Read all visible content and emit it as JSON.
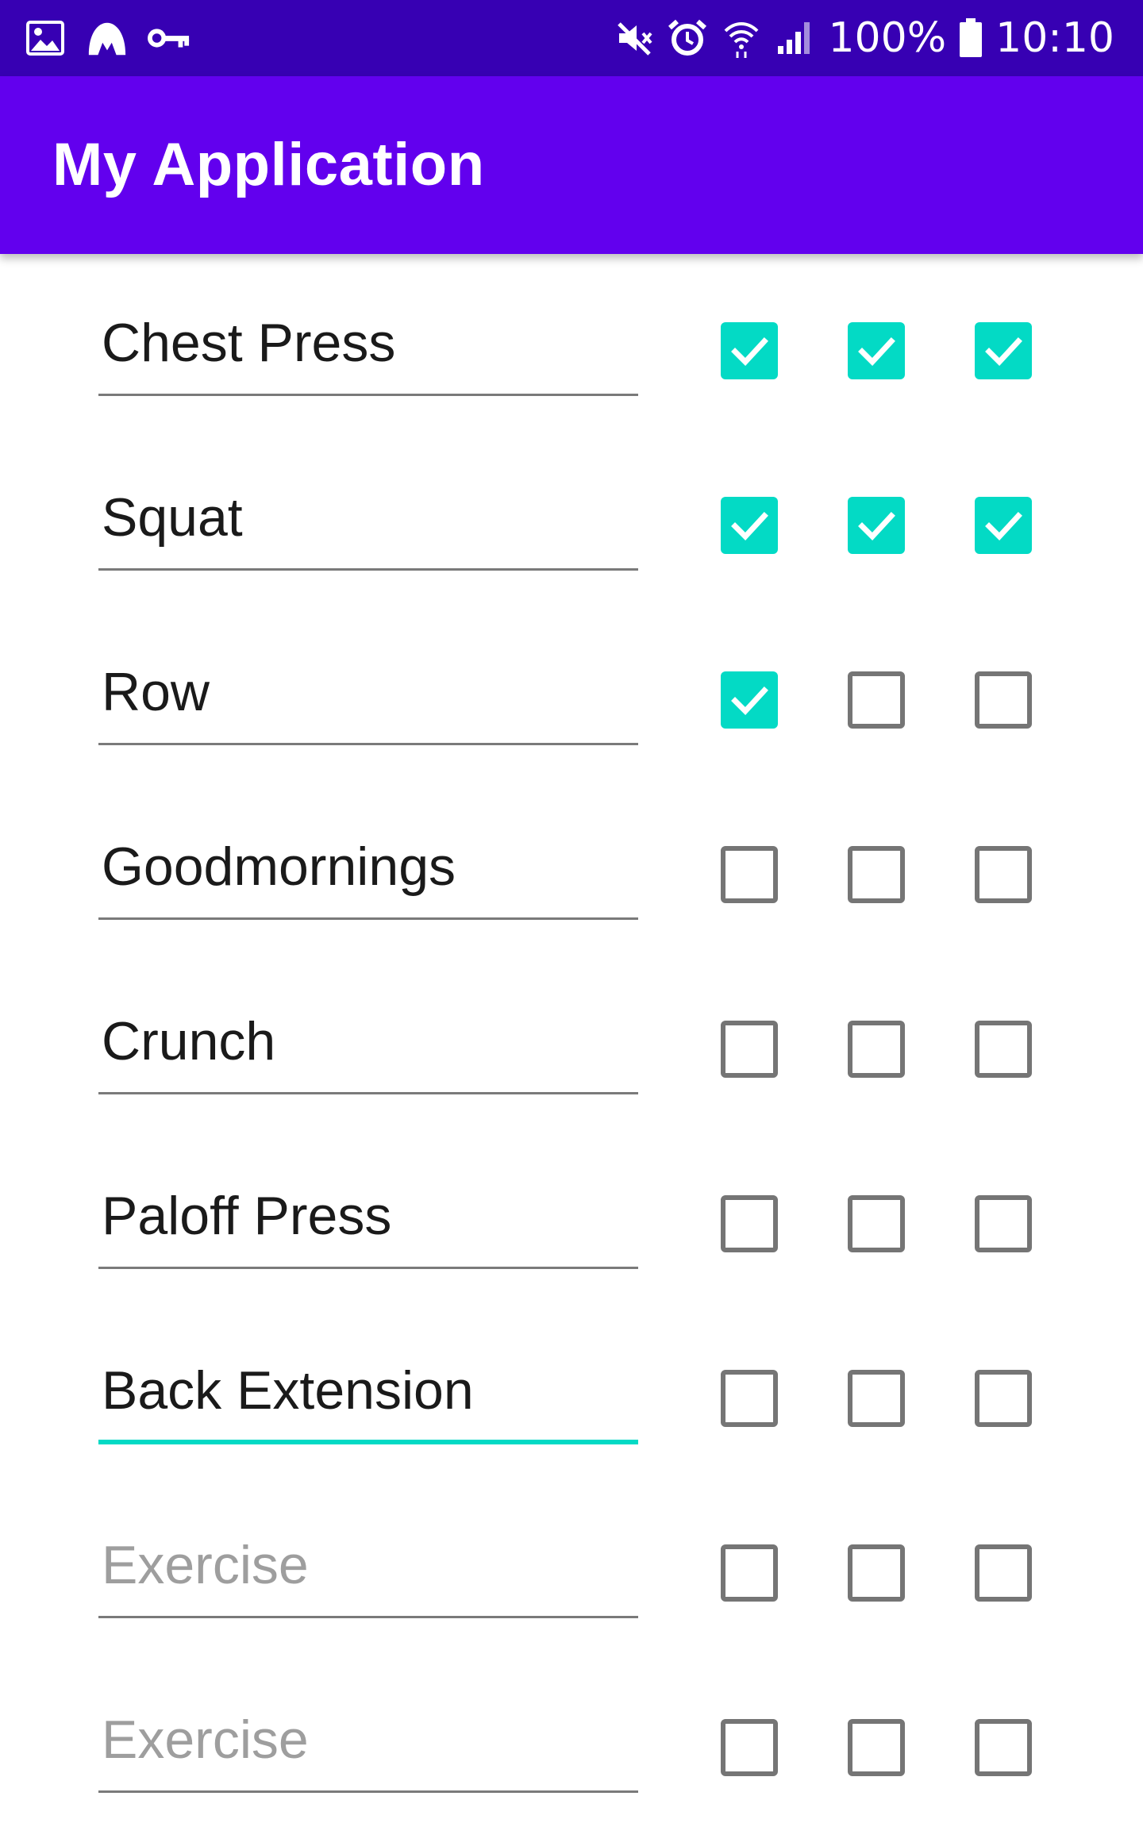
{
  "status_bar": {
    "battery_text": "100%",
    "time": "10:10",
    "left_icons": [
      "image-icon",
      "vpn-hat-icon",
      "key-icon"
    ],
    "right_icons": [
      "mute-icon",
      "alarm-icon",
      "wifi-icon",
      "signal-icon",
      "battery-icon"
    ]
  },
  "app_bar": {
    "title": "My Application"
  },
  "exercises": [
    {
      "value": "Chest Press",
      "placeholder": "",
      "sets": [
        true,
        true,
        true
      ]
    },
    {
      "value": "Squat",
      "placeholder": "",
      "sets": [
        true,
        true,
        true
      ]
    },
    {
      "value": "Row",
      "placeholder": "",
      "sets": [
        true,
        false,
        false
      ]
    },
    {
      "value": "Goodmornings",
      "placeholder": "",
      "sets": [
        false,
        false,
        false
      ]
    },
    {
      "value": "Crunch",
      "placeholder": "",
      "sets": [
        false,
        false,
        false
      ]
    },
    {
      "value": "Paloff Press",
      "placeholder": "",
      "sets": [
        false,
        false,
        false
      ]
    },
    {
      "value": "Back Extension",
      "placeholder": "",
      "sets": [
        false,
        false,
        false
      ],
      "focused": true
    },
    {
      "value": "",
      "placeholder": "Exercise",
      "sets": [
        false,
        false,
        false
      ]
    },
    {
      "value": "",
      "placeholder": "Exercise",
      "sets": [
        false,
        false,
        false
      ]
    }
  ],
  "colors": {
    "status_bar": "#3700b3",
    "app_bar": "#6200ee",
    "accent": "#03dac5",
    "unchecked_border": "#757575"
  }
}
